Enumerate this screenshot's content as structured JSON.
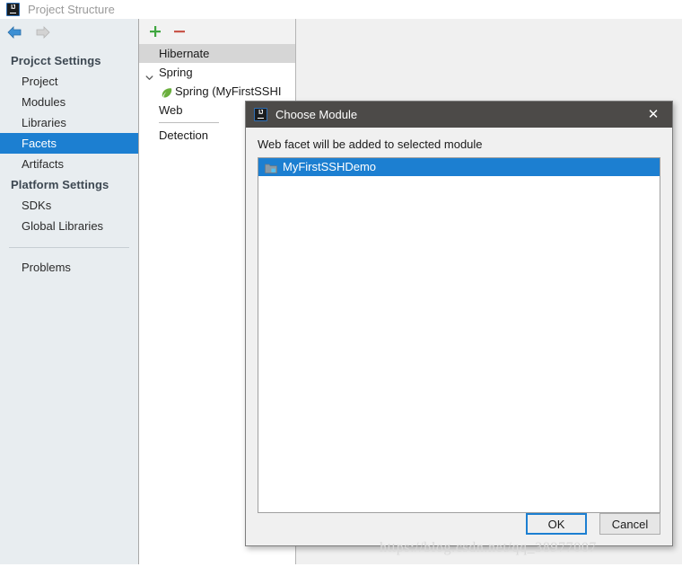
{
  "window": {
    "title": "Project Structure",
    "app_icon": "intellij-idea-icon"
  },
  "sidebar": {
    "nav": {
      "back_icon": "arrow-left-icon",
      "forward_icon": "arrow-right-icon"
    },
    "sections": [
      {
        "header": "Projcct Settings",
        "items": [
          {
            "label": "Project",
            "selected": false
          },
          {
            "label": "Modules",
            "selected": false
          },
          {
            "label": "Libraries",
            "selected": false
          },
          {
            "label": "Facets",
            "selected": true
          },
          {
            "label": "Artifacts",
            "selected": false
          }
        ]
      },
      {
        "header": "Platform Settings",
        "items": [
          {
            "label": "SDKs",
            "selected": false
          },
          {
            "label": "Global Libraries",
            "selected": false
          }
        ]
      }
    ],
    "problems_label": "Problems"
  },
  "facet_panel": {
    "toolbar": {
      "add_label": "+",
      "remove_label": "−",
      "add_icon": "plus-icon",
      "remove_icon": "minus-icon"
    },
    "rows": [
      {
        "label": "Hibernate",
        "highlight": true,
        "expandable": false,
        "indent": false,
        "icon": null
      },
      {
        "label": "Spring",
        "highlight": false,
        "expandable": true,
        "indent": false,
        "icon": null
      },
      {
        "label": "Spring (MyFirstSSHI",
        "highlight": false,
        "expandable": false,
        "indent": true,
        "icon": "spring-leaf-icon"
      },
      {
        "label": "Web",
        "highlight": false,
        "expandable": false,
        "indent": false,
        "icon": null
      },
      {
        "label": "Detection",
        "highlight": false,
        "expandable": false,
        "indent": false,
        "icon": null
      }
    ]
  },
  "dialog": {
    "title": "Choose Module",
    "icon": "intellij-idea-icon",
    "close_label": "✕",
    "prompt": "Web facet will be added to selected module",
    "modules": [
      {
        "label": "MyFirstSSHDemo",
        "selected": true,
        "icon": "module-folder-icon"
      }
    ],
    "buttons": {
      "ok": "OK",
      "cancel": "Cancel"
    }
  },
  "watermark": {
    "text": "https://blog.csdn.net/qq_38977007"
  },
  "colors": {
    "accent_selection": "#1c7fd1",
    "sidebar_bg": "#e8edf0",
    "panel_bg": "#f0f0f0",
    "dialog_titlebar": "#4c4a48",
    "row_highlight": "#d6d6d6",
    "toolbar_add": "#3fa63f",
    "toolbar_remove": "#c8554a",
    "spring_green": "#6aaf3d"
  }
}
